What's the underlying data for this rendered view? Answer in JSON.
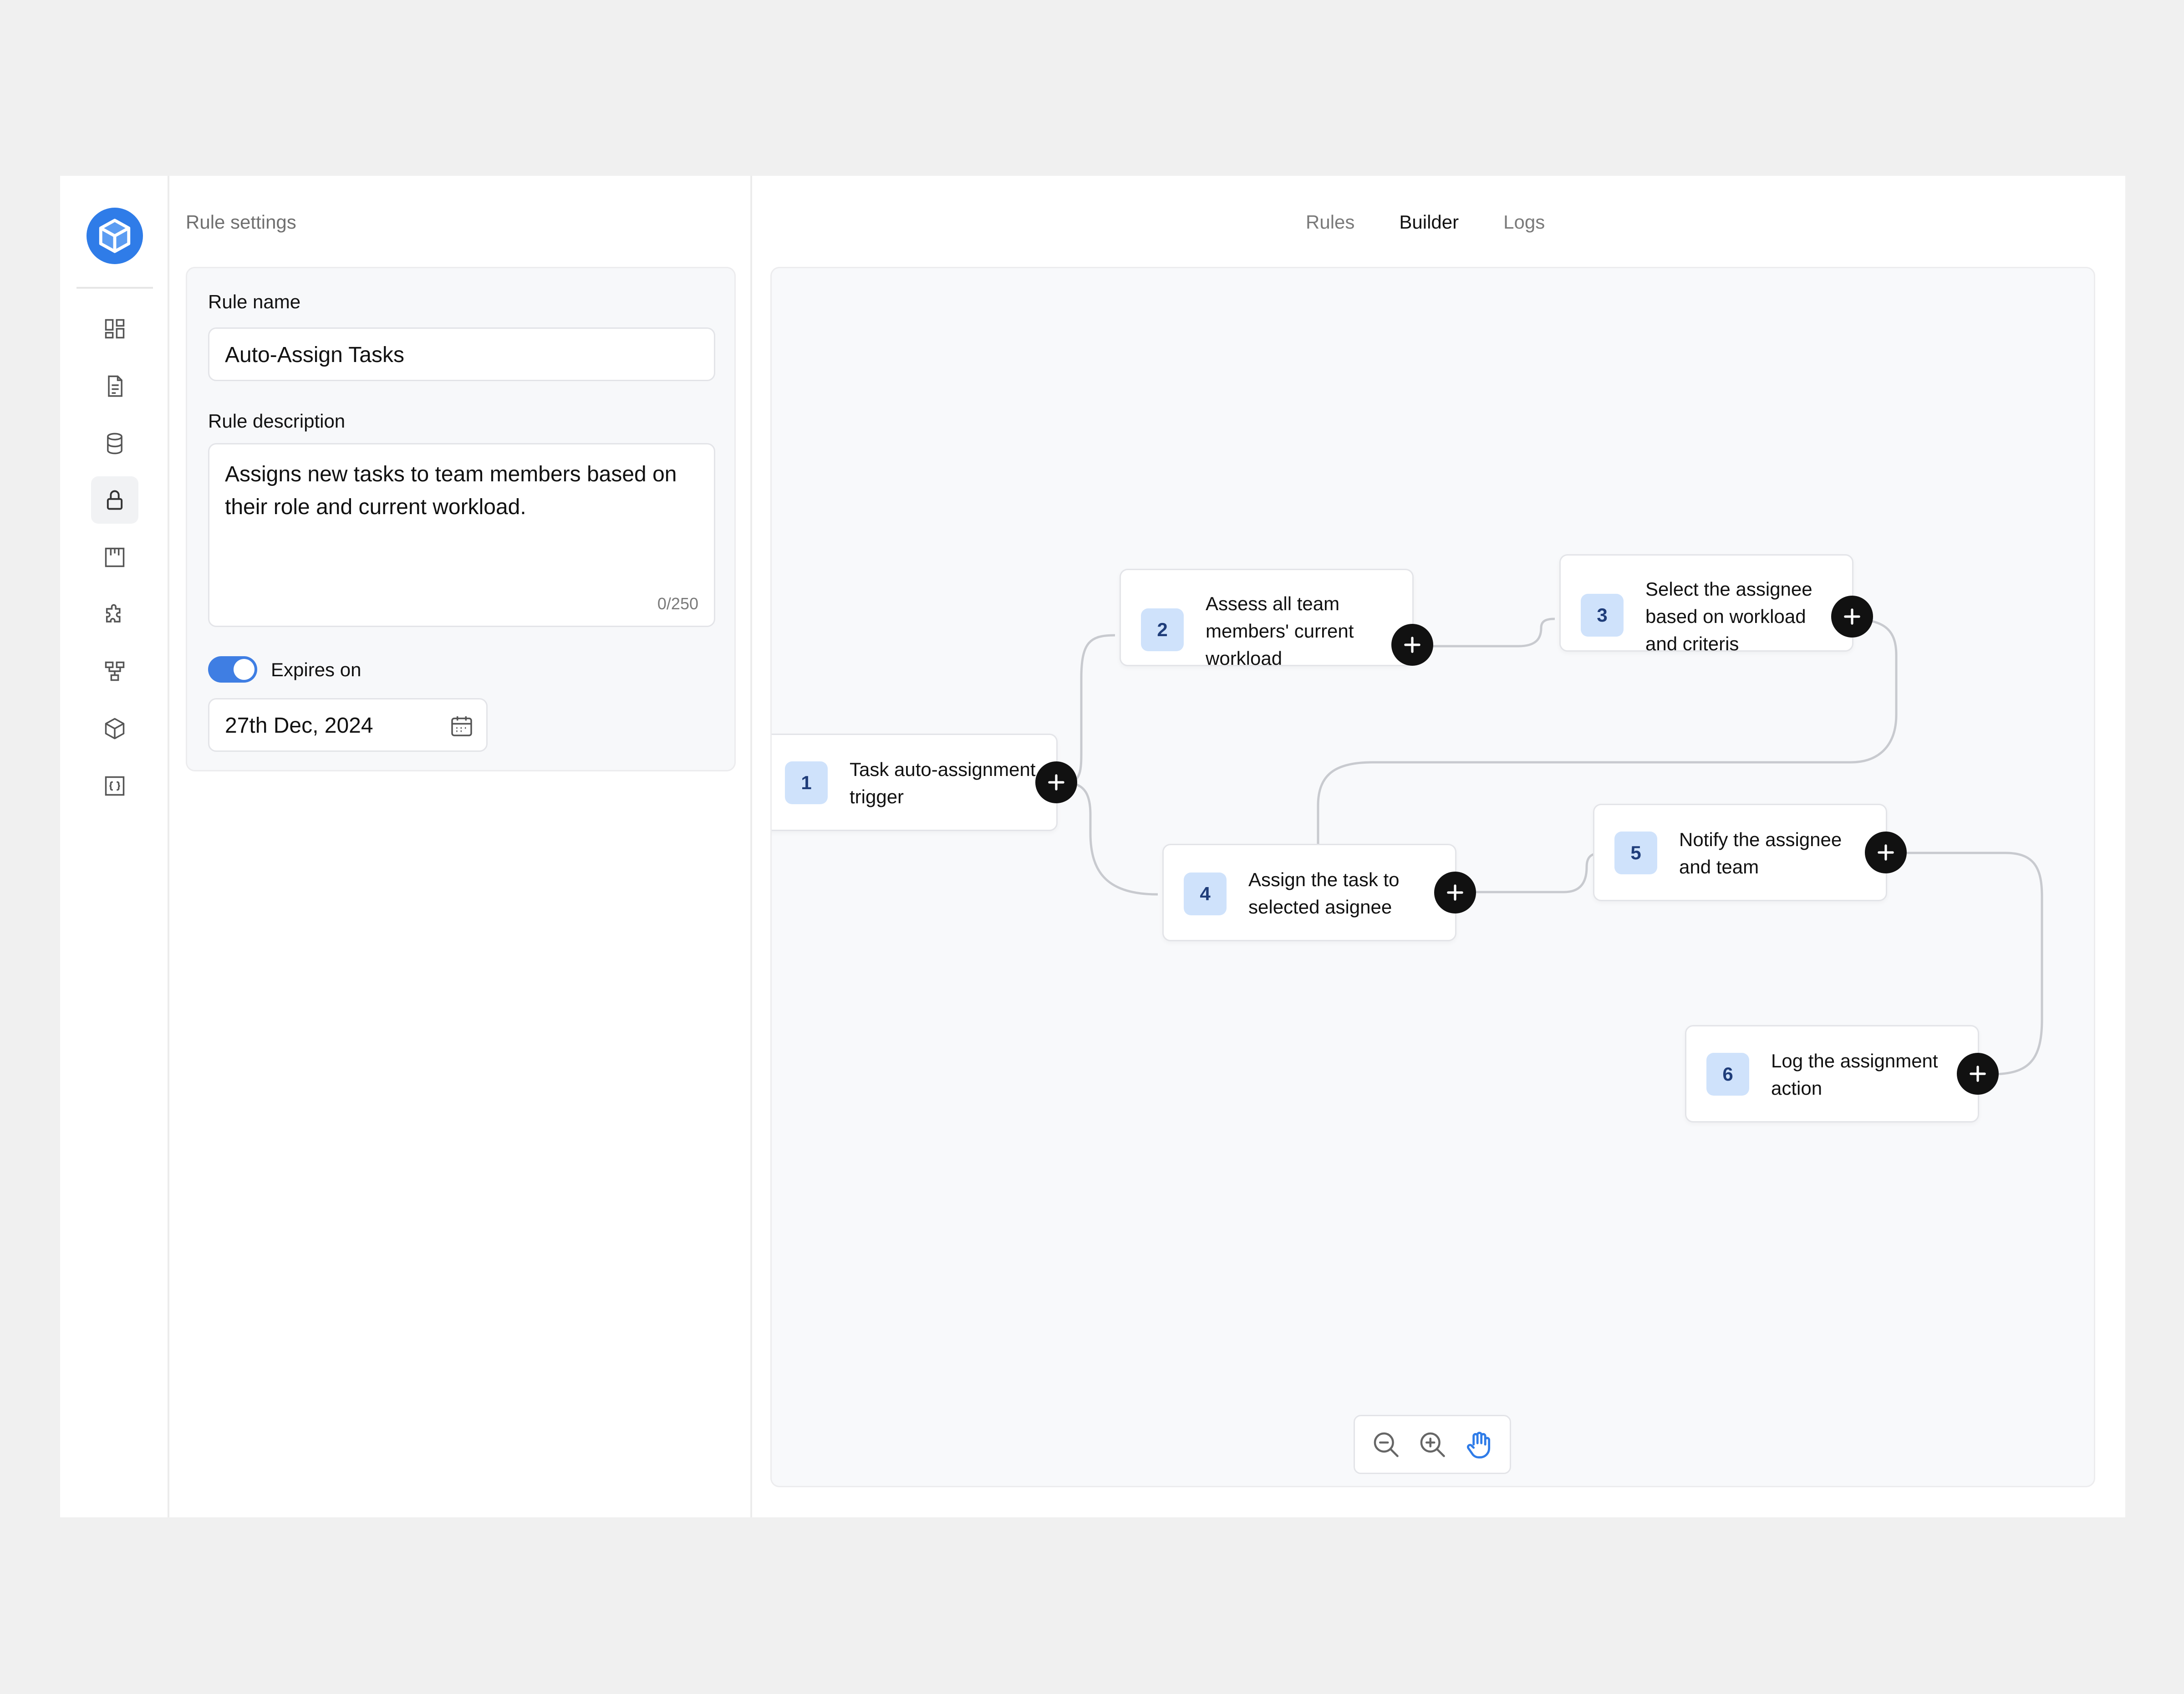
{
  "rail": {
    "logo_icon": "cube-logo-icon",
    "items": [
      {
        "icon": "dashboard-icon"
      },
      {
        "icon": "document-icon"
      },
      {
        "icon": "database-icon"
      },
      {
        "icon": "lock-icon",
        "active": true
      },
      {
        "icon": "board-icon"
      },
      {
        "icon": "puzzle-icon"
      },
      {
        "icon": "workflow-icon"
      },
      {
        "icon": "box-icon"
      },
      {
        "icon": "code-braces-icon"
      }
    ]
  },
  "settings": {
    "title": "Rule settings",
    "rule_name_label": "Rule name",
    "rule_name_value": "Auto-Assign Tasks",
    "rule_description_label": "Rule description",
    "rule_description_value": "Assigns new tasks to team members based on their role and current workload.",
    "char_counter": "0/250",
    "expires_label": "Expires on",
    "expires_enabled": true,
    "expires_date": "27th Dec, 2024"
  },
  "tabs": [
    {
      "label": "Rules",
      "active": false
    },
    {
      "label": "Builder",
      "active": true
    },
    {
      "label": "Logs",
      "active": false
    }
  ],
  "nodes": [
    {
      "num": "1",
      "text": "Task auto-assignment trigger"
    },
    {
      "num": "2",
      "text": "Assess all team members' current workload"
    },
    {
      "num": "3",
      "text": "Select the assignee based on workload and criteris"
    },
    {
      "num": "4",
      "text": "Assign the task to selected asignee"
    },
    {
      "num": "5",
      "text": "Notify the assignee and team"
    },
    {
      "num": "6",
      "text": "Log the assignment action"
    }
  ],
  "zoom_controls": [
    "zoom-out-icon",
    "zoom-in-icon",
    "hand-pan-icon"
  ],
  "colors": {
    "accent": "#3f7ee3",
    "node_badge": "#cfe2fb",
    "connector": "#c8cacf"
  }
}
